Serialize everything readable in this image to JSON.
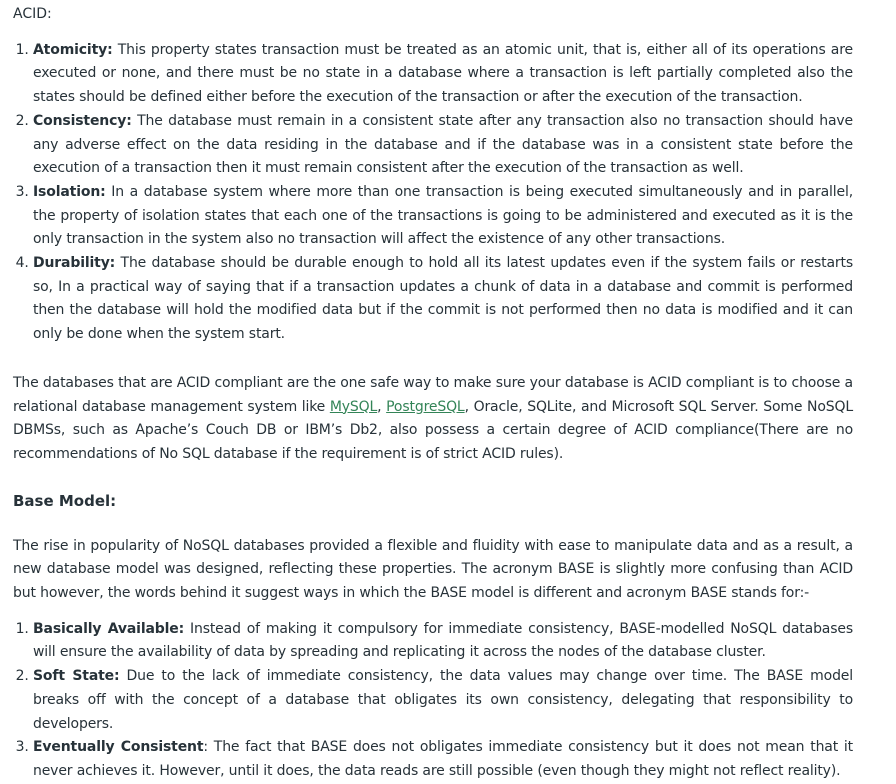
{
  "acid_intro": "ACID:",
  "acid_items": [
    {
      "term": "Atomicity:",
      "text": " This property states transaction must be treated as an atomic unit, that is, either all of its operations are executed or none, and there must be no state in a database where a transaction is left partially completed also the states should be defined either before the execution of the transaction or after the execution of the transaction."
    },
    {
      "term": "Consistency:",
      "text": " The database must remain in a consistent state after any transaction also no transaction should have any adverse effect on the data residing in the database and if the database was in a consistent state before the execution of a transaction then it must remain consistent after the execution of the transaction as well."
    },
    {
      "term": "Isolation:",
      "text": " In a database system where more than one transaction is being executed simultaneously and in parallel, the property of isolation states that each one of the transactions is going to be administered and executed as it is the only transaction in the system also no transaction will affect the existence of any other transactions."
    },
    {
      "term": "Durability:",
      "text": " The database should be durable enough to hold all its latest updates even if the system fails or restarts so, In a practical way of saying that if a transaction updates a chunk of data in a database and commit is performed then the database will hold the modified data but if the commit is not performed then no data is modified and it can only be done when the system start."
    }
  ],
  "compliance_para": {
    "before": "The databases that are ACID compliant are the one safe way to make sure your database is ACID compliant is to choose a relational database management system like ",
    "link1": "MySQL",
    "sep": ", ",
    "link2": "PostgreSQL",
    "after": ", Oracle, SQLite, and Microsoft SQL Server. Some NoSQL DBMSs, such as Apache’s Couch DB or IBM’s Db2, also possess a certain degree of ACID compliance(There are no recommendations of No SQL database if the requirement is of strict ACID rules)."
  },
  "base_heading": "Base Model:",
  "base_para": "The rise in popularity of NoSQL databases provided a flexible and fluidity with ease to manipulate data and as a result, a new database model was designed, reflecting these properties. The acronym BASE is slightly more confusing than ACID but however, the words behind it suggest ways in which the BASE model is different and acronym BASE stands for:-",
  "base_items": [
    {
      "term": "Basically Available:",
      "text": " Instead of making it compulsory for immediate consistency, BASE-modelled NoSQL databases will ensure the availability of data by spreading and replicating it across the nodes of the database cluster."
    },
    {
      "term": "Soft State:",
      "text": " Due to the lack of immediate consistency, the data values may change over time. The BASE model breaks off with the concept of a database that obligates its own consistency, delegating that responsibility to developers."
    },
    {
      "term": "Eventually Consistent",
      "text": ": The fact that BASE does not obligates immediate consistency but it does not mean that it never achieves it. However, until it does, the data reads are still possible (even though they might not reflect reality)."
    }
  ]
}
